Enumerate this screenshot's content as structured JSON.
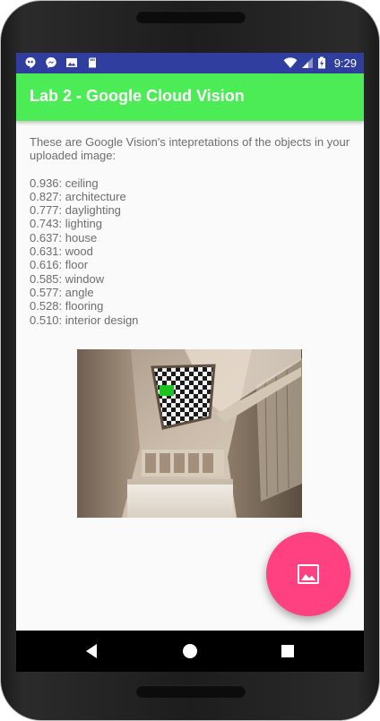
{
  "status_bar": {
    "time": "9:29",
    "notification_icons": [
      "hangouts-icon",
      "messenger-icon",
      "gallery-icon",
      "sd-card-icon"
    ],
    "system_icons": [
      "wifi-icon",
      "signal-icon",
      "battery-charging-icon"
    ]
  },
  "app_bar": {
    "title": "Lab 2 - Google Cloud Vision",
    "color": "#4cec56"
  },
  "content": {
    "intro": "These are Google Vision's intepretations of the objects in your uploaded image:",
    "results": [
      {
        "text": "0.936: ceiling"
      },
      {
        "text": "0.827: architecture"
      },
      {
        "text": "0.777: daylighting"
      },
      {
        "text": "0.743: lighting"
      },
      {
        "text": "0.637: house"
      },
      {
        "text": "0.631: wood"
      },
      {
        "text": "0.616: floor"
      },
      {
        "text": "0.585: window"
      },
      {
        "text": "0.577: angle"
      },
      {
        "text": "0.528: flooring"
      },
      {
        "text": "0.510: interior design"
      }
    ]
  },
  "image": {
    "description_icon": "uploaded-room-photo"
  },
  "fab": {
    "icon": "image-icon",
    "color": "#ff4081"
  },
  "nav_bar": {
    "buttons": [
      "back-icon",
      "home-icon",
      "recents-icon"
    ]
  },
  "colors": {
    "status_bar": "#303f9f",
    "app_bar": "#4cec56",
    "accent": "#ff4081",
    "body_text": "#6d6d6d"
  }
}
